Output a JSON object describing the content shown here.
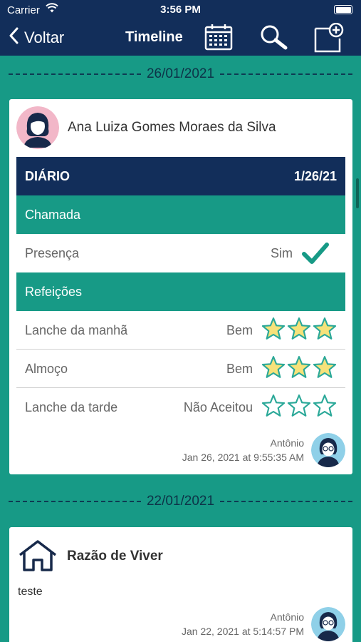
{
  "status_bar": {
    "carrier": "Carrier",
    "time": "3:56 PM"
  },
  "nav": {
    "back_label": "Voltar",
    "title": "Timeline"
  },
  "timeline": [
    {
      "date": "26/01/2021",
      "author_name": "Ana Luiza Gomes Moraes da Silva",
      "diary": {
        "title": "DIÁRIO",
        "date": "1/26/21",
        "sections": [
          {
            "title": "Chamada",
            "items": [
              {
                "label": "Presença",
                "value": "Sim",
                "icon": "check-icon"
              }
            ]
          },
          {
            "title": "Refeições",
            "items": [
              {
                "label": "Lanche da manhã",
                "value": "Bem",
                "rating": 3,
                "max_rating": 3
              },
              {
                "label": "Almoço",
                "value": "Bem",
                "rating": 3,
                "max_rating": 3
              },
              {
                "label": "Lanche da tarde",
                "value": "Não Aceitou",
                "rating": 0,
                "max_rating": 3
              }
            ]
          }
        ]
      },
      "posted_by": "Antônio",
      "posted_at": "Jan 26, 2021 at 9:55:35 AM"
    },
    {
      "date": "22/01/2021",
      "title": "Razão de Viver",
      "body": "teste",
      "posted_by": "Antônio",
      "posted_at": "Jan 22, 2021 at 5:14:57 PM"
    }
  ],
  "colors": {
    "navy": "#122e5a",
    "teal": "#179a86",
    "star": "#f6e27a",
    "star_outline": "#2aa898"
  },
  "icons": {
    "back": "chevron-left-icon",
    "calendar": "calendar-icon",
    "search": "search-icon",
    "new_post": "new-post-icon",
    "home": "house-icon",
    "wifi": "wifi-icon",
    "battery": "battery-icon"
  }
}
